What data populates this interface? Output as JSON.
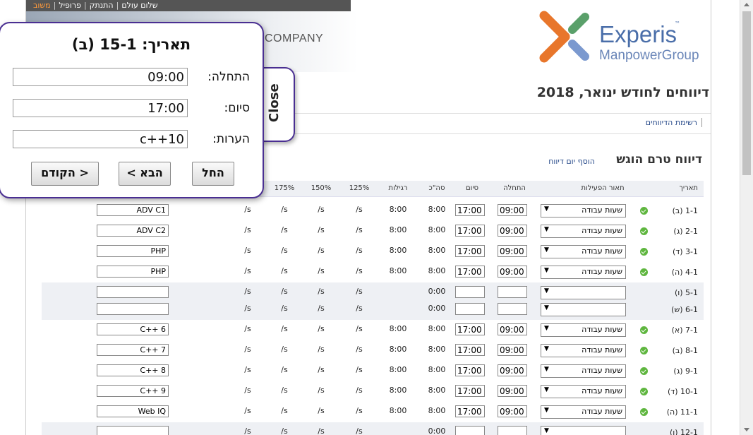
{
  "topbar": {
    "greeting": "שלום עולם",
    "links": [
      "התנתק",
      "פרופיל",
      "משוב"
    ]
  },
  "banner": {
    "company": "COMPANY"
  },
  "logo": {
    "name": "Experis",
    "tm": "™",
    "group": "ManpowerGroup"
  },
  "page_title": "דיווחים לחודש ינואר, 2018",
  "nav": {
    "reports_list": "רשימת הדיווחים"
  },
  "section": {
    "title": "דיווח טרם הוגש",
    "add_day": "הוסף יום דיווח"
  },
  "table": {
    "headers": {
      "date": "תאריך",
      "activity": "תאור הפעילות",
      "start": "התחלה",
      "end": "סיום",
      "total": "סה\"כ",
      "regular": "רגילות",
      "p125": "125%",
      "p150": "150%",
      "p175": "175%"
    },
    "rows": [
      {
        "date": "1-1 (ב)",
        "ok": true,
        "activity": "שעות עבודה",
        "start": "09:00",
        "end": "17:00",
        "total": "8:00",
        "regular": "8:00",
        "p125": "s/",
        "p150": "s/",
        "p175": "s/",
        "px": "s/",
        "note": "ADV C1",
        "weekend": false
      },
      {
        "date": "2-1 (ג)",
        "ok": true,
        "activity": "שעות עבודה",
        "start": "09:00",
        "end": "17:00",
        "total": "8:00",
        "regular": "8:00",
        "p125": "s/",
        "p150": "s/",
        "p175": "s/",
        "px": "s/",
        "note": "ADV C2",
        "weekend": false
      },
      {
        "date": "3-1 (ד)",
        "ok": true,
        "activity": "שעות עבודה",
        "start": "09:00",
        "end": "17:00",
        "total": "8:00",
        "regular": "8:00",
        "p125": "s/",
        "p150": "s/",
        "p175": "s/",
        "px": "s/",
        "note": "PHP",
        "weekend": false
      },
      {
        "date": "4-1 (ה)",
        "ok": true,
        "activity": "שעות עבודה",
        "start": "09:00",
        "end": "17:00",
        "total": "8:00",
        "regular": "8:00",
        "p125": "s/",
        "p150": "s/",
        "p175": "s/",
        "px": "s/",
        "note": "PHP",
        "weekend": false
      },
      {
        "date": "5-1 (ו)",
        "ok": false,
        "activity": "",
        "start": "",
        "end": "",
        "total": "0:00",
        "regular": "",
        "p125": "s/",
        "p150": "s/",
        "p175": "s/",
        "px": "s/",
        "note": "",
        "weekend": true
      },
      {
        "date": "6-1 (ש)",
        "ok": false,
        "activity": "",
        "start": "",
        "end": "",
        "total": "0:00",
        "regular": "",
        "p125": "s/",
        "p150": "s/",
        "p175": "s/",
        "px": "s/",
        "note": "",
        "weekend": true
      },
      {
        "date": "7-1 (א)",
        "ok": true,
        "activity": "שעות עבודה",
        "start": "09:00",
        "end": "17:00",
        "total": "8:00",
        "regular": "8:00",
        "p125": "s/",
        "p150": "s/",
        "p175": "s/",
        "px": "s/",
        "note": "C++ 6",
        "weekend": false
      },
      {
        "date": "8-1 (ב)",
        "ok": true,
        "activity": "שעות עבודה",
        "start": "09:00",
        "end": "17:00",
        "total": "8:00",
        "regular": "8:00",
        "p125": "s/",
        "p150": "s/",
        "p175": "s/",
        "px": "s/",
        "note": "C++ 7",
        "weekend": false
      },
      {
        "date": "9-1 (ג)",
        "ok": true,
        "activity": "שעות עבודה",
        "start": "09:00",
        "end": "17:00",
        "total": "8:00",
        "regular": "8:00",
        "p125": "s/",
        "p150": "s/",
        "p175": "s/",
        "px": "s/",
        "note": "C++ 8",
        "weekend": false
      },
      {
        "date": "10-1 (ד)",
        "ok": true,
        "activity": "שעות עבודה",
        "start": "09:00",
        "end": "17:00",
        "total": "8:00",
        "regular": "8:00",
        "p125": "s/",
        "p150": "s/",
        "p175": "s/",
        "px": "s/",
        "note": "C++ 9",
        "weekend": false
      },
      {
        "date": "11-1 (ה)",
        "ok": true,
        "activity": "שעות עבודה",
        "start": "09:00",
        "end": "17:00",
        "total": "8:00",
        "regular": "8:00",
        "p125": "s/",
        "p150": "s/",
        "p175": "s/",
        "px": "s/",
        "note": "Web IQ",
        "weekend": false
      },
      {
        "date": "12-1 (ו)",
        "ok": false,
        "activity": "",
        "start": "",
        "end": "",
        "total": "0:00",
        "regular": "",
        "p125": "s/",
        "p150": "s/",
        "p175": "s/",
        "px": "s/",
        "note": "",
        "weekend": true
      }
    ]
  },
  "popup": {
    "title": "תאריך: 15-1 (ב)",
    "start_label": "התחלה:",
    "start_value": "09:00",
    "end_label": "סיום:",
    "end_value": "17:00",
    "notes_label": "הערות:",
    "notes_value": "c++10",
    "close": "Close",
    "btn_apply": "החל",
    "btn_next": "הבא >",
    "btn_prev": "< הקודם"
  },
  "colors": {
    "accent": "#4a2f92",
    "link": "#274a8a",
    "ok": "#5fb63f",
    "logo_orange": "#e8762b",
    "logo_green": "#5aa06a",
    "logo_blue": "#4a6ea9"
  }
}
